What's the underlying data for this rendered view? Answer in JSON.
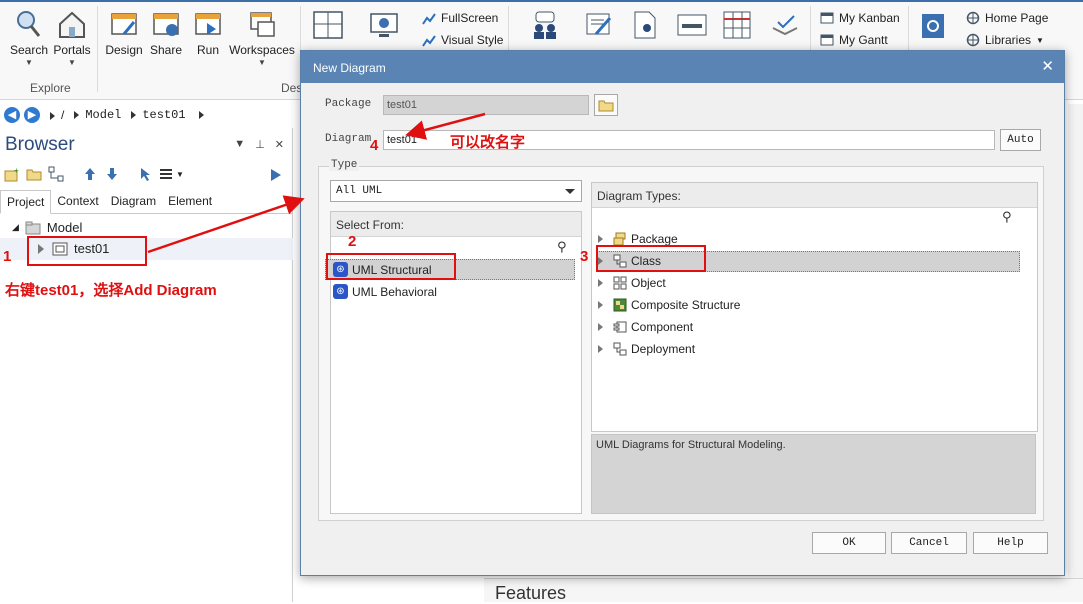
{
  "ribbon": {
    "buttons": [
      {
        "label": "Search",
        "icon": "search-icon"
      },
      {
        "label": "Portals",
        "icon": "portal-icon"
      },
      {
        "label": "Design",
        "icon": "design-icon"
      },
      {
        "label": "Share",
        "icon": "share-icon"
      },
      {
        "label": "Run",
        "icon": "run-icon"
      },
      {
        "label": "Workspaces",
        "icon": "workspaces-icon"
      }
    ],
    "groups": {
      "explore": "Explore",
      "design": "Des"
    },
    "small": {
      "fullscreen": "FullScreen",
      "visual_style": "Visual Style",
      "my_kanban": "My Kanban",
      "my_gantt": "My Gantt",
      "home_page": "Home Page",
      "libraries": "Libraries"
    }
  },
  "breadcrumb": {
    "separator": "/",
    "model": "Model",
    "item": "test01"
  },
  "browser": {
    "title": "Browser",
    "tabs": [
      "Project",
      "Context",
      "Diagram",
      "Element"
    ],
    "active_tab": "Project",
    "tree": {
      "root": "Model",
      "child": "test01"
    }
  },
  "annotations": {
    "n1": "1",
    "n2": "2",
    "n3": "3",
    "n4": "4",
    "hint1": "右键test01，选择Add Diagram",
    "hint4": "可以改名字"
  },
  "dialog": {
    "title": "New Diagram",
    "package_label": "Package",
    "package_value": "test01",
    "diagram_label": "Diagram",
    "diagram_value": "test01",
    "auto_label": "Auto",
    "type_label": "Type",
    "type_select": "All UML",
    "select_from_header": "Select From:",
    "select_from_items": [
      "UML Structural",
      "UML Behavioral"
    ],
    "diagram_types_header": "Diagram Types:",
    "diagram_types": [
      "Package",
      "Class",
      "Object",
      "Composite Structure",
      "Component",
      "Deployment"
    ],
    "description": "UML Diagrams for Structural Modeling.",
    "ok_label": "OK",
    "cancel_label": "Cancel",
    "help_label": "Help"
  },
  "features": "Features"
}
